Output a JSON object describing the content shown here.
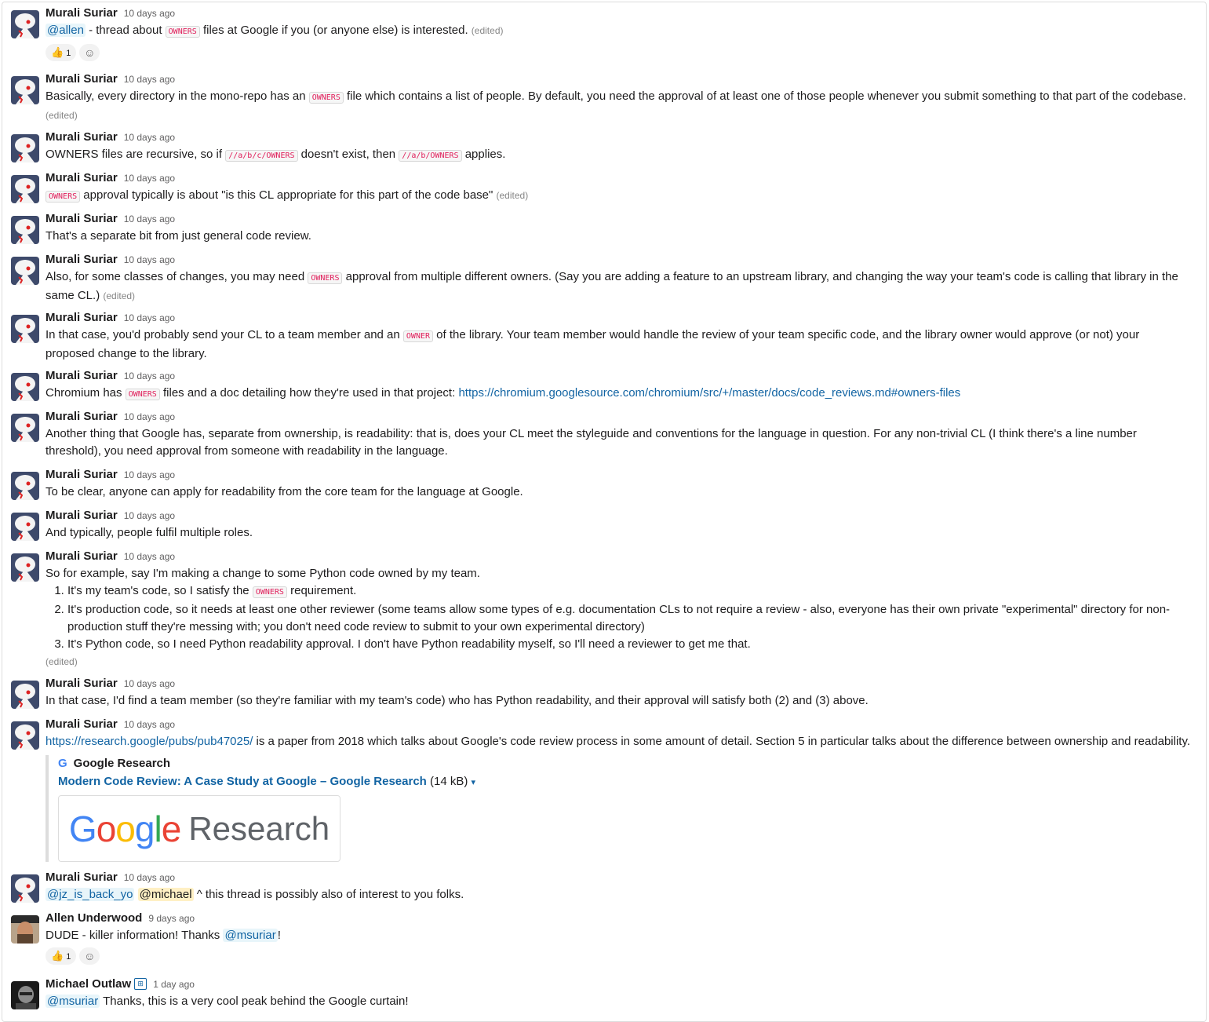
{
  "messages": [
    {
      "author": "Murali Suriar",
      "time": "10 days ago"
    },
    {
      "author": "Murali Suriar",
      "time": "10 days ago"
    },
    {
      "author": "Murali Suriar",
      "time": "10 days ago"
    },
    {
      "author": "Murali Suriar",
      "time": "10 days ago"
    },
    {
      "author": "Murali Suriar",
      "time": "10 days ago"
    },
    {
      "author": "Murali Suriar",
      "time": "10 days ago"
    },
    {
      "author": "Murali Suriar",
      "time": "10 days ago"
    },
    {
      "author": "Murali Suriar",
      "time": "10 days ago"
    },
    {
      "author": "Murali Suriar",
      "time": "10 days ago"
    },
    {
      "author": "Murali Suriar",
      "time": "10 days ago"
    },
    {
      "author": "Murali Suriar",
      "time": "10 days ago"
    },
    {
      "author": "Murali Suriar",
      "time": "10 days ago"
    },
    {
      "author": "Murali Suriar",
      "time": "10 days ago"
    },
    {
      "author": "Murali Suriar",
      "time": "10 days ago"
    },
    {
      "author": "Murali Suriar",
      "time": "10 days ago"
    },
    {
      "author": "Allen Underwood",
      "time": "9 days ago"
    },
    {
      "author": "Michael Outlaw",
      "time": "1 day ago"
    }
  ],
  "text": {
    "m1_mention": "@allen",
    "m1_a": " - thread about ",
    "m1_code": "OWNERS",
    "m1_b": " files at Google if you (or anyone else) is interested. ",
    "edited": "(edited)",
    "m2_a": "Basically, every directory in the mono-repo has an ",
    "m2_code": "OWNERS",
    "m2_b": " file which contains a list of people. By default, you need the approval of at least one of those people whenever you submit something to that part of the codebase. ",
    "m3_a": "OWNERS files are recursive, so if ",
    "m3_code1": "//a/b/c/OWNERS",
    "m3_b": " doesn't exist, then ",
    "m3_code2": "//a/b/OWNERS",
    "m3_c": " applies.",
    "m4_code": "OWNERS",
    "m4_a": " approval typically is about \"is this CL appropriate for this part of the code base\" ",
    "m5": "That's a separate bit from just general code review.",
    "m6_a": "Also, for some classes of changes, you may need ",
    "m6_code": "OWNERS",
    "m6_b": " approval from multiple different owners. (Say you are adding a feature to an upstream library, and changing the way your team's code is calling that library in the same CL.) ",
    "m7_a": "In that case, you'd probably send your CL to a team member and an ",
    "m7_code": "OWNER",
    "m7_b": " of the library. Your team member would handle the review of your team specific code, and the library owner would approve (or not) your proposed change to the library.",
    "m8_a": "Chromium has ",
    "m8_code": "OWNERS",
    "m8_b": " files and a doc detailing how they're used in that project: ",
    "m8_link": "https://chromium.googlesource.com/chromium/src/+/master/docs/code_reviews.md#owners-files",
    "m9": "Another thing that Google has, separate from ownership, is readability: that is, does your CL meet the styleguide and conventions for the language in question. For any non-trivial CL (I think there's a line number threshold), you need approval from someone with readability in the language.",
    "m10": "To be clear, anyone can apply for readability from the core team for the language at Google.",
    "m11": "And typically, people fulfil multiple roles.",
    "m12_intro": "So for example, say I'm making a change to some Python code owned by my team.",
    "m12_li1_a": "It's my team's code, so I satisfy the ",
    "m12_li1_code": "OWNERS",
    "m12_li1_b": " requirement.",
    "m12_li2": "It's production code, so it needs at least one other reviewer (some teams allow some types of e.g. documentation CLs to not require a review - also, everyone has their own private \"experimental\" directory for non-production stuff they're messing with; you don't need code review to submit to your own experimental directory)",
    "m12_li3": "It's Python code, so I need Python readability approval. I don't have Python readability myself, so I'll need a reviewer to get me that.",
    "m13": "In that case, I'd find a team member (so they're familiar with my team's code) who has Python readability, and their approval will satisfy both (2) and (3) above.",
    "m14_link": "https://research.google/pubs/pub47025/",
    "m14_b": " is a paper from 2018 which talks about Google's code review process in some amount of detail. Section 5 in particular talks about the difference between ownership and readability.",
    "unfurl_site": "Google Research",
    "unfurl_g": "G",
    "unfurl_title": "Modern Code Review: A Case Study at Google – Google Research",
    "unfurl_size": " (14 kB) ",
    "unfurl_caret": "▾",
    "thumb_research": "Research",
    "m15_mention1": "@jz_is_back_yo",
    "m15_mention2": "@michael",
    "m15_b": " ^ this thread is possibly also of interest to you folks.",
    "m16_a": "DUDE - killer information!  Thanks ",
    "m16_mention": "@msuriar",
    "m16_b": "!",
    "m17_mention": "@msuriar",
    "m17_b": " Thanks, this is a very cool peak behind the Google curtain!"
  },
  "reactions": {
    "r1": {
      "emoji": "👍",
      "count": "1"
    },
    "r2": {
      "emoji": "👍",
      "count": "1"
    }
  },
  "icons": {
    "add_reaction": "☺",
    "bot": "⊞"
  },
  "colors": {
    "mention": "#1264a3",
    "code": "#e01e5a",
    "link": "#1264a3"
  }
}
